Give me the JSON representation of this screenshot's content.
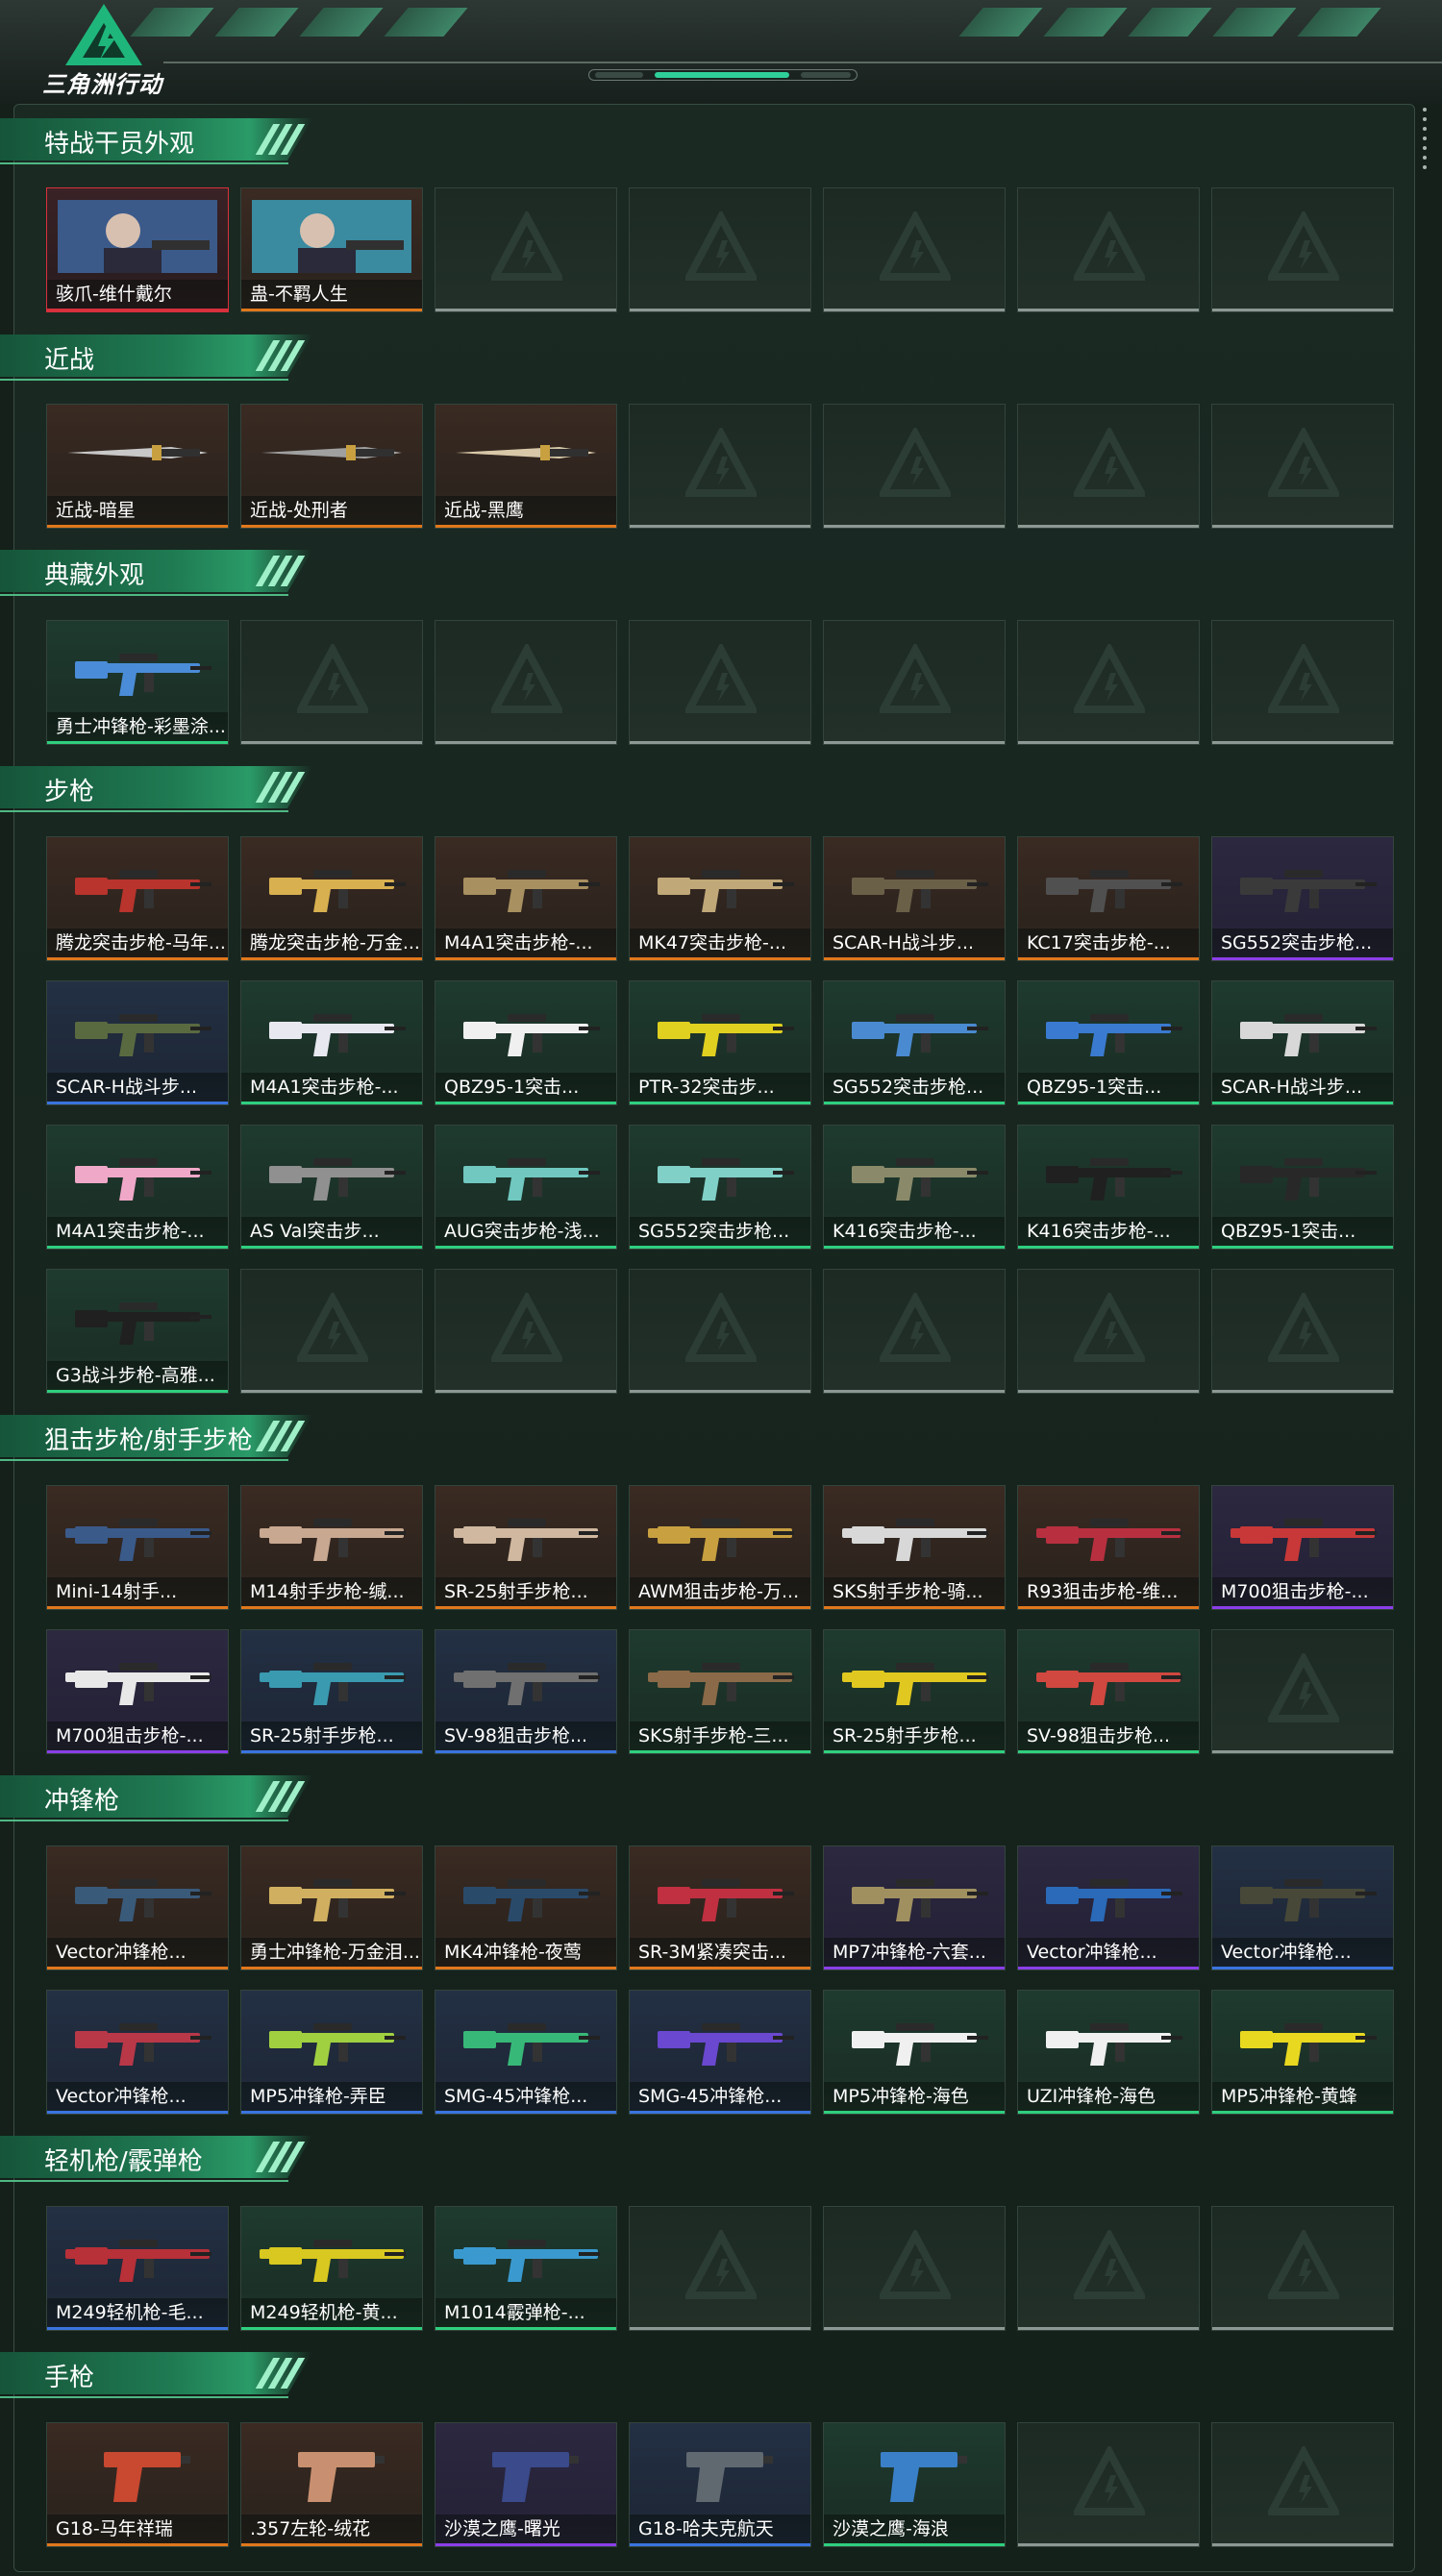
{
  "header": {
    "logo_text": "三角洲行动"
  },
  "colors": {
    "orange": "#e0781c",
    "purple": "#8a3ee8",
    "blue": "#3a74e0",
    "green": "#2fcf7e",
    "red": "#d8303c",
    "empty": "#8c9893"
  },
  "categories": [
    {
      "title": "特战干员外观",
      "rows": [
        [
          {
            "label": "骇爪-维什戴尔",
            "rarity": "red",
            "icon": "operator-portrait-icon",
            "tint": "#3b5a8a"
          },
          {
            "label": "蛊-不羁人生",
            "rarity": "orange",
            "icon": "operator-portrait-icon",
            "tint": "#3a8aa0"
          },
          null,
          null,
          null,
          null,
          null
        ]
      ]
    },
    {
      "title": "近战",
      "rows": [
        [
          {
            "label": "近战-暗星",
            "rarity": "orange",
            "icon": "knife-icon",
            "tint": "#c8c8c8"
          },
          {
            "label": "近战-处刑者",
            "rarity": "orange",
            "icon": "knife-icon",
            "tint": "#a0a0a0"
          },
          {
            "label": "近战-黑鹰",
            "rarity": "orange",
            "icon": "knife-icon",
            "tint": "#d8c8a8"
          },
          null,
          null,
          null,
          null
        ]
      ]
    },
    {
      "title": "典藏外观",
      "rows": [
        [
          {
            "label": "勇士冲锋枪-彩墨涂...",
            "rarity": "green",
            "icon": "smg-icon",
            "tint": "#4a8cd8"
          },
          null,
          null,
          null,
          null,
          null,
          null
        ]
      ]
    },
    {
      "title": "步枪",
      "rows": [
        [
          {
            "label": "腾龙突击步枪-马年...",
            "rarity": "orange",
            "icon": "rifle-icon",
            "tint": "#b8342c"
          },
          {
            "label": "腾龙突击步枪-万金...",
            "rarity": "orange",
            "icon": "rifle-icon",
            "tint": "#d8b050"
          },
          {
            "label": "M4A1突击步枪-...",
            "rarity": "orange",
            "icon": "rifle-icon",
            "tint": "#a89060"
          },
          {
            "label": "MK47突击步枪-...",
            "rarity": "orange",
            "icon": "rifle-icon",
            "tint": "#c0a878"
          },
          {
            "label": "SCAR-H战斗步...",
            "rarity": "orange",
            "icon": "rifle-icon",
            "tint": "#6a6048"
          },
          {
            "label": "KC17突击步枪-...",
            "rarity": "orange",
            "icon": "rifle-icon",
            "tint": "#505050"
          },
          {
            "label": "SG552突击步枪...",
            "rarity": "purple",
            "icon": "rifle-icon",
            "tint": "#3a3a3a"
          }
        ],
        [
          {
            "label": "SCAR-H战斗步...",
            "rarity": "blue",
            "icon": "rifle-icon",
            "tint": "#5a6a40"
          },
          {
            "label": "M4A1突击步枪-...",
            "rarity": "green",
            "icon": "rifle-icon",
            "tint": "#e8e8f0"
          },
          {
            "label": "QBZ95-1突击...",
            "rarity": "green",
            "icon": "rifle-icon",
            "tint": "#f0f0f0"
          },
          {
            "label": "PTR-32突击步...",
            "rarity": "green",
            "icon": "rifle-icon",
            "tint": "#e0d020"
          },
          {
            "label": "SG552突击步枪...",
            "rarity": "green",
            "icon": "rifle-icon",
            "tint": "#4a8ad0"
          },
          {
            "label": "QBZ95-1突击...",
            "rarity": "green",
            "icon": "rifle-icon",
            "tint": "#3a7ad0"
          },
          {
            "label": "SCAR-H战斗步...",
            "rarity": "green",
            "icon": "rifle-icon",
            "tint": "#d8d8d8"
          }
        ],
        [
          {
            "label": "M4A1突击步枪-...",
            "rarity": "green",
            "icon": "rifle-icon",
            "tint": "#f0a8c8"
          },
          {
            "label": "AS Val突击步...",
            "rarity": "green",
            "icon": "rifle-icon",
            "tint": "#909090"
          },
          {
            "label": "AUG突击步枪-浅...",
            "rarity": "green",
            "icon": "rifle-icon",
            "tint": "#70c8c0"
          },
          {
            "label": "SG552突击步枪...",
            "rarity": "green",
            "icon": "rifle-icon",
            "tint": "#80d0c8"
          },
          {
            "label": "K416突击步枪-...",
            "rarity": "green",
            "icon": "rifle-icon",
            "tint": "#8a8a6a"
          },
          {
            "label": "K416突击步枪-...",
            "rarity": "green",
            "icon": "rifle-icon",
            "tint": "#202020"
          },
          {
            "label": "QBZ95-1突击...",
            "rarity": "green",
            "icon": "rifle-icon",
            "tint": "#282828"
          }
        ],
        [
          {
            "label": "G3战斗步枪-高雅...",
            "rarity": "green",
            "icon": "rifle-icon",
            "tint": "#202020"
          },
          null,
          null,
          null,
          null,
          null,
          null
        ]
      ]
    },
    {
      "title": "狙击步枪/射手步枪",
      "rows": [
        [
          {
            "label": "Mini-14射手...",
            "rarity": "orange",
            "icon": "sniper-icon",
            "tint": "#3a5a8a"
          },
          {
            "label": "M14射手步枪-缄...",
            "rarity": "orange",
            "icon": "sniper-icon",
            "tint": "#c8a890"
          },
          {
            "label": "SR-25射手步枪...",
            "rarity": "orange",
            "icon": "sniper-icon",
            "tint": "#d0b8a0"
          },
          {
            "label": "AWM狙击步枪-万...",
            "rarity": "orange",
            "icon": "sniper-icon",
            "tint": "#c8a040"
          },
          {
            "label": "SKS射手步枪-骑...",
            "rarity": "orange",
            "icon": "sniper-icon",
            "tint": "#d8d8d8"
          },
          {
            "label": "R93狙击步枪-维...",
            "rarity": "orange",
            "icon": "sniper-icon",
            "tint": "#b83040"
          },
          {
            "label": "M700狙击步枪-...",
            "rarity": "purple",
            "icon": "sniper-icon",
            "tint": "#c83838"
          }
        ],
        [
          {
            "label": "M700狙击步枪-...",
            "rarity": "purple",
            "icon": "sniper-icon",
            "tint": "#e8e8e8"
          },
          {
            "label": "SR-25射手步枪...",
            "rarity": "blue",
            "icon": "sniper-icon",
            "tint": "#3a9ab0"
          },
          {
            "label": "SV-98狙击步枪...",
            "rarity": "blue",
            "icon": "sniper-icon",
            "tint": "#707070"
          },
          {
            "label": "SKS射手步枪-三...",
            "rarity": "green",
            "icon": "sniper-icon",
            "tint": "#8a6a48"
          },
          {
            "label": "SR-25射手步枪...",
            "rarity": "green",
            "icon": "sniper-icon",
            "tint": "#e0c820"
          },
          {
            "label": "SV-98狙击步枪...",
            "rarity": "green",
            "icon": "sniper-icon",
            "tint": "#d04840"
          },
          null
        ]
      ]
    },
    {
      "title": "冲锋枪",
      "rows": [
        [
          {
            "label": "Vector冲锋枪...",
            "rarity": "orange",
            "icon": "smg-icon",
            "tint": "#3a5a7a"
          },
          {
            "label": "勇士冲锋枪-万金泪...",
            "rarity": "orange",
            "icon": "smg-icon",
            "tint": "#d0b060"
          },
          {
            "label": "MK4冲锋枪-夜莺",
            "rarity": "orange",
            "icon": "smg-icon",
            "tint": "#2a4a6a"
          },
          {
            "label": "SR-3M紧凑突击...",
            "rarity": "orange",
            "icon": "smg-icon",
            "tint": "#c03040"
          },
          {
            "label": "MP7冲锋枪-六套...",
            "rarity": "purple",
            "icon": "smg-icon",
            "tint": "#a09060"
          },
          {
            "label": "Vector冲锋枪...",
            "rarity": "purple",
            "icon": "smg-icon",
            "tint": "#2a6ab8"
          },
          {
            "label": "Vector冲锋枪...",
            "rarity": "blue",
            "icon": "smg-icon",
            "tint": "#484838"
          }
        ],
        [
          {
            "label": "Vector冲锋枪...",
            "rarity": "blue",
            "icon": "smg-icon",
            "tint": "#b83848"
          },
          {
            "label": "MP5冲锋枪-弄臣",
            "rarity": "blue",
            "icon": "smg-icon",
            "tint": "#a0d040"
          },
          {
            "label": "SMG-45冲锋枪...",
            "rarity": "blue",
            "icon": "smg-icon",
            "tint": "#38b878"
          },
          {
            "label": "SMG-45冲锋枪...",
            "rarity": "blue",
            "icon": "smg-icon",
            "tint": "#6a48d0"
          },
          {
            "label": "MP5冲锋枪-海色",
            "rarity": "green",
            "icon": "smg-icon",
            "tint": "#f0f0f0"
          },
          {
            "label": "UZI冲锋枪-海色",
            "rarity": "green",
            "icon": "smg-icon",
            "tint": "#f0f0f0"
          },
          {
            "label": "MP5冲锋枪-黄蜂",
            "rarity": "green",
            "icon": "smg-icon",
            "tint": "#e8d820"
          }
        ]
      ]
    },
    {
      "title": "轻机枪/霰弹枪",
      "rows": [
        [
          {
            "label": "M249轻机枪-毛...",
            "rarity": "blue",
            "icon": "lmg-icon",
            "tint": "#b83038"
          },
          {
            "label": "M249轻机枪-黄...",
            "rarity": "green",
            "icon": "lmg-icon",
            "tint": "#d8c820"
          },
          {
            "label": "M1014霰弹枪-...",
            "rarity": "green",
            "icon": "shotgun-icon",
            "tint": "#3a9ad0"
          },
          null,
          null,
          null,
          null
        ]
      ]
    },
    {
      "title": "手枪",
      "rows": [
        [
          {
            "label": "G18-马年祥瑞",
            "rarity": "orange",
            "icon": "pistol-icon",
            "tint": "#c84830"
          },
          {
            "label": ".357左轮-绒花",
            "rarity": "orange",
            "icon": "revolver-icon",
            "tint": "#c89070"
          },
          {
            "label": "沙漠之鹰-曙光",
            "rarity": "purple",
            "icon": "pistol-icon",
            "tint": "#3a4a8a"
          },
          {
            "label": "G18-哈夫克航天",
            "rarity": "blue",
            "icon": "pistol-icon",
            "tint": "#606870"
          },
          {
            "label": "沙漠之鹰-海浪",
            "rarity": "green",
            "icon": "pistol-icon",
            "tint": "#3a80c8"
          },
          null,
          null
        ]
      ]
    }
  ]
}
